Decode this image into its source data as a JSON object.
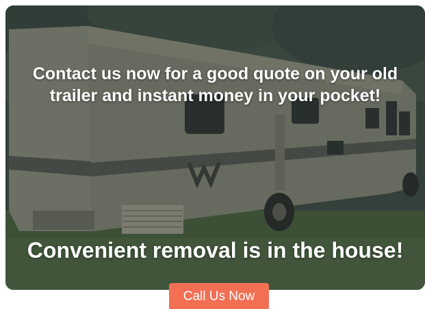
{
  "hero": {
    "headline_line1": "Contact us now for a good quote on your old",
    "headline_line2": "trailer and instant money in your pocket!",
    "tagline": "Convenient removal is in the house!",
    "image": "rv-trailer-photo"
  },
  "cta": {
    "label": "Call Us Now"
  },
  "colors": {
    "cta_background": "#f36f54",
    "overlay": "#28302e",
    "text": "#ffffff"
  }
}
